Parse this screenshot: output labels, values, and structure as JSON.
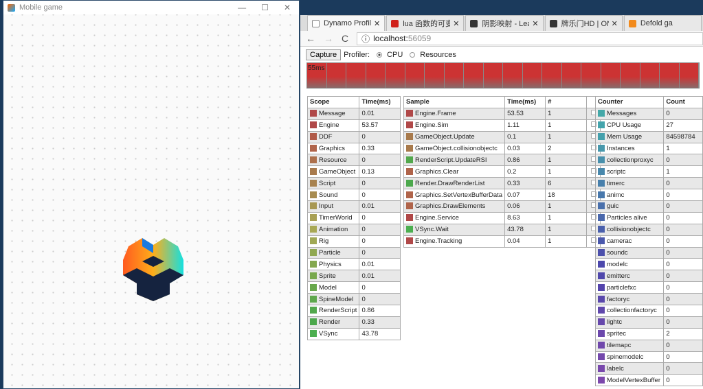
{
  "game_window": {
    "title": "Mobile game",
    "minimize": "—",
    "maximize": "☐",
    "close": "✕"
  },
  "browser": {
    "tabs": [
      {
        "label": "Dynamo Profiler",
        "icon": "page-icon",
        "color": "#ffffff",
        "active": true
      },
      {
        "label": "lua 函数的可变参数 - 专栏",
        "icon": "csdn-icon",
        "color": "#d0201a"
      },
      {
        "label": "阴影映射 - LearnOpenGL",
        "icon": "book-icon",
        "color": "#333333"
      },
      {
        "label": "牌乐门HD | ONES Project",
        "icon": "ones-icon",
        "color": "#333333"
      },
      {
        "label": "Defold ga",
        "icon": "defold-icon",
        "color": "#f28a1c"
      }
    ],
    "url_host": "localhost:",
    "url_port": "56059"
  },
  "toolbar": {
    "capture": "Capture",
    "profiler_label": "Profiler:",
    "cpu": "CPU",
    "resources": "Resources",
    "selected": "CPU"
  },
  "graph": {
    "label": "55ms",
    "frame_count": 20,
    "bar_color": "#cc3333"
  },
  "scope": {
    "headers": [
      "Scope",
      "Time(ms)"
    ],
    "rows": [
      [
        "Message",
        "0.01",
        "#b04848"
      ],
      [
        "Engine",
        "53.57",
        "#b04848"
      ],
      [
        "DDF",
        "0",
        "#b05a48"
      ],
      [
        "Graphics",
        "0.33",
        "#b0644a"
      ],
      [
        "Resource",
        "0",
        "#ad704c"
      ],
      [
        "GameObject",
        "0.13",
        "#a87a4c"
      ],
      [
        "Script",
        "0",
        "#a8824e"
      ],
      [
        "Sound",
        "0",
        "#a88c50"
      ],
      [
        "Input",
        "0.01",
        "#a89852"
      ],
      [
        "TimerWorld",
        "0",
        "#a8a054"
      ],
      [
        "Animation",
        "0",
        "#a8a854"
      ],
      [
        "Rig",
        "0",
        "#a0a854"
      ],
      [
        "Particle",
        "0",
        "#90a850"
      ],
      [
        "Physics",
        "0.01",
        "#84a84e"
      ],
      [
        "Sprite",
        "0.01",
        "#78a84c"
      ],
      [
        "Model",
        "0",
        "#68a84c"
      ],
      [
        "SpineModel",
        "0",
        "#5ea84c"
      ],
      [
        "RenderScript",
        "0.86",
        "#52a84c"
      ],
      [
        "Render",
        "0.33",
        "#4ca84c"
      ],
      [
        "VSync",
        "43.78",
        "#4caf50"
      ]
    ]
  },
  "sample": {
    "headers": [
      "Sample",
      "Time(ms)",
      "#",
      ""
    ],
    "rows": [
      [
        "Engine.Frame",
        "53.53",
        "1",
        "#b04848"
      ],
      [
        "Engine.Sim",
        "1.11",
        "1",
        "#b04848"
      ],
      [
        "GameObject.Update",
        "0.1",
        "1",
        "#a87a4c"
      ],
      [
        "GameObject.collisionobjectc",
        "0.03",
        "2",
        "#a87a4c"
      ],
      [
        "RenderScript.UpdateRSI",
        "0.86",
        "1",
        "#52a84c"
      ],
      [
        "Graphics.Clear",
        "0.2",
        "1",
        "#b0644a"
      ],
      [
        "Render.DrawRenderList",
        "0.33",
        "6",
        "#4ca84c"
      ],
      [
        "Graphics.SetVertexBufferData",
        "0.07",
        "18",
        "#b0644a"
      ],
      [
        "Graphics.DrawElements",
        "0.06",
        "1",
        "#b0644a"
      ],
      [
        "Engine.Service",
        "8.63",
        "1",
        "#b04848"
      ],
      [
        "VSync.Wait",
        "43.78",
        "1",
        "#4caf50"
      ],
      [
        "Engine.Tracking",
        "0.04",
        "1",
        "#b04848"
      ]
    ]
  },
  "counter": {
    "headers": [
      "Counter",
      "Count"
    ],
    "rows": [
      [
        "Messages",
        "0",
        "#44a8a8"
      ],
      [
        "CPU Usage",
        "27",
        "#44a4ac"
      ],
      [
        "Mem Usage",
        "84598784",
        "#44a0ac"
      ],
      [
        "Instances",
        "1",
        "#4898ac"
      ],
      [
        "collectionproxyc",
        "0",
        "#4890ac"
      ],
      [
        "scriptc",
        "1",
        "#4888ac"
      ],
      [
        "timerc",
        "0",
        "#4880ac"
      ],
      [
        "animc",
        "0",
        "#4878ac"
      ],
      [
        "guic",
        "0",
        "#4a70ac"
      ],
      [
        "Particles alive",
        "0",
        "#4a68ac"
      ],
      [
        "collisionobjectc",
        "0",
        "#4a60ac"
      ],
      [
        "camerac",
        "0",
        "#4a58ac"
      ],
      [
        "soundc",
        "0",
        "#4c50ac"
      ],
      [
        "modelc",
        "0",
        "#4c48ac"
      ],
      [
        "emitterc",
        "0",
        "#5048ac"
      ],
      [
        "particlefxc",
        "0",
        "#5444ac"
      ],
      [
        "factoryc",
        "0",
        "#5a48ac"
      ],
      [
        "collectionfactoryc",
        "0",
        "#6048ac"
      ],
      [
        "lightc",
        "0",
        "#6648ac"
      ],
      [
        "spritec",
        "2",
        "#6c48ac"
      ],
      [
        "tilemapc",
        "0",
        "#7048ac"
      ],
      [
        "spinemodelc",
        "0",
        "#7448ac"
      ],
      [
        "labelc",
        "0",
        "#7848ac"
      ],
      [
        "ModelVertexBuffer",
        "0",
        "#7c48ac"
      ]
    ]
  }
}
